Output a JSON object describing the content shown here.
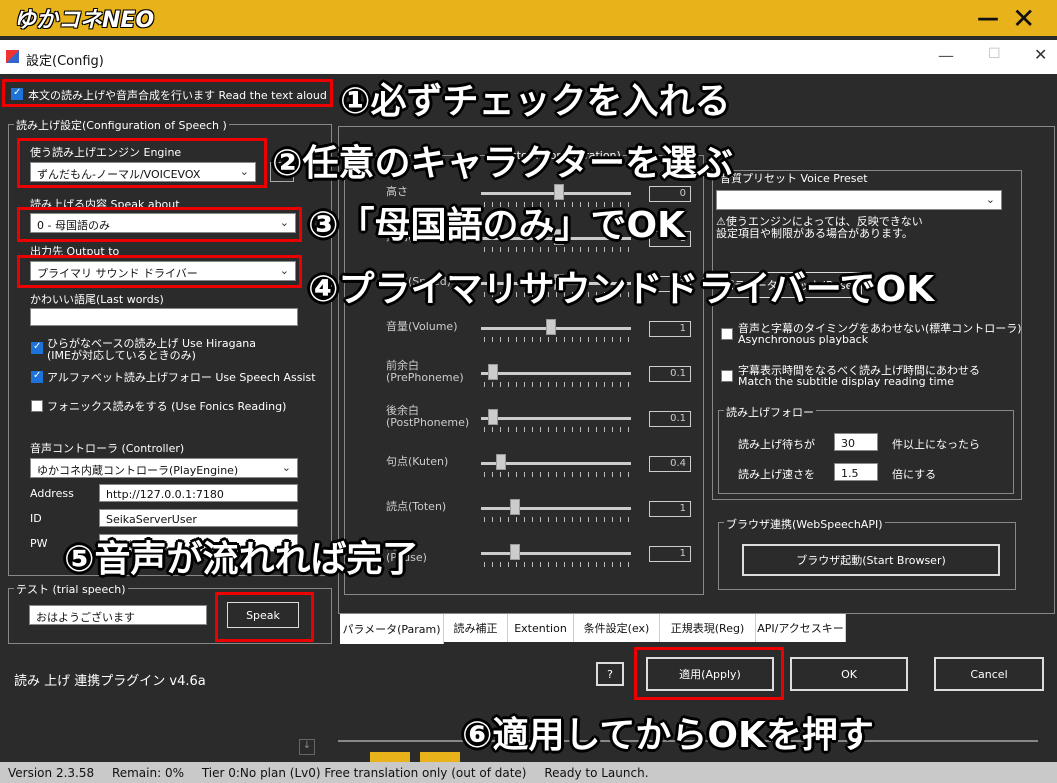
{
  "app": {
    "title": "ゆかコネNEO",
    "minimize": "—",
    "close": "✕"
  },
  "dialog": {
    "title": "設定(Config)",
    "minimize": "—",
    "maximize": "☐",
    "close": "✕"
  },
  "read_aloud_checkbox": {
    "label": "本文の読み上げや音声合成を行います  Read the text aloud",
    "checked": true
  },
  "speech_config": {
    "group_title": "読み上げ設定(Configuration of Speech )",
    "engine_label": "使う読み上げエンジン  Engine",
    "engine_value": "ずんだもん-ノーマル/VOICEVOX",
    "speak_about_label": "読み上げる内容 Speak about",
    "speak_about_value": "0 - 母国語のみ",
    "output_label": "出力先  Output to",
    "output_value": "プライマリ サウンド ドライバー",
    "last_words_label": "かわいい語尾(Last words)",
    "last_words_value": "",
    "hiragana_label": "ひらがなベースの読み上げ  Use Hiragana",
    "hiragana_sub": "(IMEが対応しているときのみ)",
    "hiragana_checked": true,
    "assist_label": "アルファベット読み上げフォロー  Use Speech Assist",
    "assist_checked": true,
    "fonics_label": "フォニックス読みをする (Use Fonics Reading)",
    "fonics_checked": false,
    "controller_label": "音声コントローラ (Controller)",
    "controller_value": "ゆかコネ内蔵コントローラ(PlayEngine)",
    "address_label": "Address",
    "address_value": "http://127.0.0.1:7180",
    "id_label": "ID",
    "id_value": "SeikaServerUser",
    "pw_label": "PW",
    "pw_value": "********"
  },
  "trial": {
    "group_title": "テスト (trial speech)",
    "text": "おはようございます",
    "speak_button": "Speak"
  },
  "plugin_version": "読み 上げ 連携プラグイン v4.6a",
  "custom_config": {
    "group_title": "(Custom Configuration)",
    "params": [
      {
        "label": "高さ",
        "value": "0",
        "level": 0.5
      },
      {
        "label": "抑揚(Accent)",
        "value": "1",
        "level": 0.5
      },
      {
        "label": "速さ(Speed)",
        "value": "1",
        "level": 0.5
      },
      {
        "label": "音量(Volume)",
        "value": "1",
        "level": 0.45
      },
      {
        "label": "前余白\n(PrePhoneme)",
        "value": "0.1",
        "level": 0.05
      },
      {
        "label": "後余白\n(PostPhoneme)",
        "value": "0.1",
        "level": 0.05
      },
      {
        "label": "句点(Kuten)",
        "value": "0.4",
        "level": 0.1
      },
      {
        "label": "読点(Toten)",
        "value": "1",
        "level": 0.2
      },
      {
        "label": "間\n(Pause)",
        "value": "1",
        "level": 0.2
      }
    ]
  },
  "voice_preset": {
    "label": "音質プリセット  Voice Preset",
    "value": "",
    "warning": "⚠使うエンジンによっては、反映できない\n設定項目や制限がある場合があります。",
    "reset_button": "パラメータリセット(Reset)"
  },
  "async_checkbox": {
    "label": "音声と字幕のタイミングをあわせない(標準コントローラ)",
    "sub": "Asynchronous playback",
    "checked": false
  },
  "subtitle_checkbox": {
    "label": "字幕表示時間をなるべく読み上げ時間にあわせる",
    "sub": "Match the subtitle display reading time",
    "checked": false
  },
  "follow": {
    "group_title": "読み上げフォロー",
    "wait_label": "読み上げ待ちが",
    "wait_value": "30",
    "wait_suffix": "件以上になったら",
    "speed_label": "読み上げ速さを",
    "speed_value": "1.5",
    "speed_suffix": "倍にする"
  },
  "browser": {
    "group_title": "ブラウザ連携(WebSpeechAPI)",
    "button": "ブラウザ起動(Start Browser)"
  },
  "tabs": [
    "パラメータ(Param)",
    "読み補正",
    "Extention",
    "条件設定(ex)",
    "正規表現(Reg)",
    "API/アクセスキー"
  ],
  "help_button": "?",
  "apply_button": "適用(Apply)",
  "ok_button": "OK",
  "cancel_button": "Cancel",
  "annotations": [
    "①必ずチェックを入れる",
    "②任意のキャラクターを選ぶ",
    "③「母国語のみ」でOK",
    "④プライマリサウンドドライバーでOK",
    "⑤音声が流れれば完了",
    "⑥適用してからOKを押す"
  ],
  "status": {
    "version": "Version 2.3.58",
    "remain": "Remain:  0%",
    "tier": "Tier 0:No plan (Lv0) Free translation only (out of date)",
    "ready": "Ready to Launch."
  },
  "colors": {
    "accent": "#e8b21a",
    "annotation_border": "#ee0000",
    "checkbox": "#1e73d8",
    "dialog_bg": "#2b2b2b"
  }
}
